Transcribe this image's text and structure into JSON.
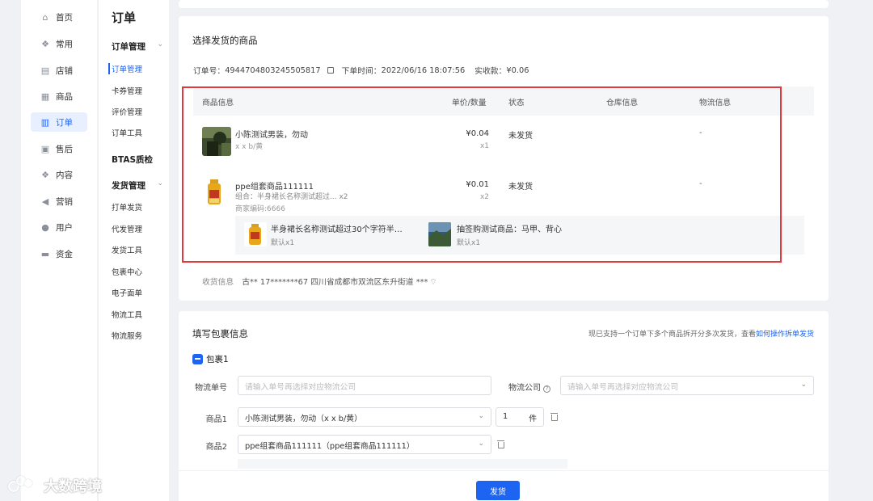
{
  "nav1": [
    {
      "label": "首页",
      "icon": "home-icon",
      "glyph": "⌂"
    },
    {
      "label": "常用",
      "icon": "apps-icon",
      "glyph": "❖"
    },
    {
      "label": "店铺",
      "icon": "shop-icon",
      "glyph": "▤"
    },
    {
      "label": "商品",
      "icon": "goods-icon",
      "glyph": "▦"
    },
    {
      "label": "订单",
      "icon": "order-icon",
      "glyph": "▥"
    },
    {
      "label": "售后",
      "icon": "aftersale-icon",
      "glyph": "▣"
    },
    {
      "label": "内容",
      "icon": "content-icon",
      "glyph": "❖"
    },
    {
      "label": "营销",
      "icon": "marketing-icon",
      "glyph": "◀"
    },
    {
      "label": "用户",
      "icon": "user-icon",
      "glyph": "●"
    },
    {
      "label": "资金",
      "icon": "wallet-icon",
      "glyph": "▬"
    }
  ],
  "nav2": {
    "title": "订单",
    "group1": "订单管理",
    "group1_items": [
      "订单管理",
      "卡券管理",
      "评价管理",
      "订单工具"
    ],
    "group2": "BTAS质检",
    "group3": "发货管理",
    "group3_items": [
      "打单发货",
      "代发管理",
      "发货工具",
      "包裹中心",
      "电子面单",
      "物流工具",
      "物流服务"
    ]
  },
  "goods_section": {
    "title": "选择发货的商品",
    "order_no_label": "订单号：",
    "order_no": "4944704803245505817",
    "order_time_label": "下单时间：",
    "order_time": "2022/06/16 18:07:56",
    "paid_label": "实收款：",
    "paid": "¥0.06",
    "columns": [
      "商品信息",
      "单价/数量",
      "状态",
      "仓库信息",
      "物流信息"
    ],
    "items": [
      {
        "name": "小陈测试男装，勿动",
        "spec": "x x b/黄",
        "price": "¥0.04",
        "qty": "x1",
        "status": "未发货",
        "logistics": "-"
      },
      {
        "name": "ppe组套商品111111",
        "spec": "组合：半身裙长名称测试超过...  x2",
        "code": "商家编码:6666",
        "price": "¥0.01",
        "qty": "x2",
        "status": "未发货",
        "logistics": "-"
      }
    ],
    "sub_items": [
      {
        "name": "半身裙长名称测试超过30个字符半…",
        "spec": "默认x1"
      },
      {
        "name": "抽签购测试商品：马甲、背心",
        "spec": "默认x1"
      }
    ],
    "address_label": "收货信息",
    "address": "古**  17*******67  四川省成都市双流区东升街道 ***"
  },
  "package_section": {
    "title": "填写包裹信息",
    "hint": "现已支持一个订单下多个商品拆开分多次发货，查看",
    "hint_link": "如何操作拆单发货",
    "package_label": "包裹1",
    "tracking_label": "物流单号",
    "tracking_placeholder": "请输入单号再选择对应物流公司",
    "carrier_label": "物流公司",
    "carrier_placeholder": "请输入单号再选择对应物流公司",
    "goods1_label": "商品1",
    "goods1_value": "小陈测试男装，勿动（x x b/黄）",
    "goods1_qty": "1",
    "qty_unit": "件",
    "goods2_label": "商品2",
    "goods2_value": "ppe组套商品111111（ppe组套商品111111）"
  },
  "footer": {
    "ship_button": "发货"
  },
  "watermark": "大数跨境",
  "colors": {
    "accent": "#1d64f2",
    "highlight_border": "#e4393c"
  }
}
